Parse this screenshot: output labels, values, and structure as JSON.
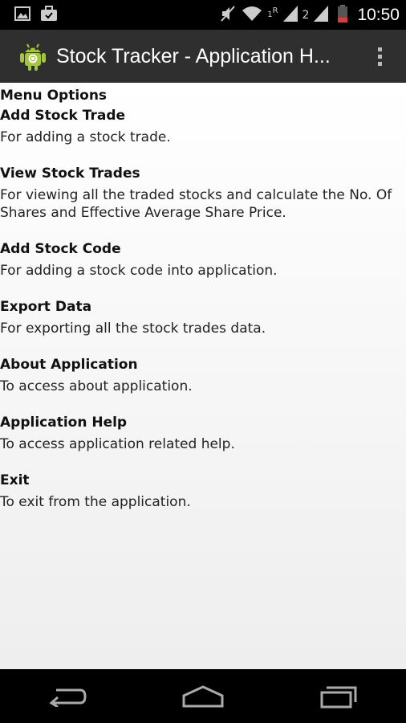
{
  "status_bar": {
    "time": "10:50",
    "signal_1_label": "1",
    "roaming_label": "R",
    "signal_2_label": "2",
    "icons": [
      "image-icon",
      "briefcase-icon",
      "mute-icon",
      "wifi-icon",
      "signal-icon",
      "battery-icon"
    ]
  },
  "action_bar": {
    "title": "Stock Tracker - Application H...",
    "icon": "android-app-icon",
    "overflow_icon": "overflow-menu-icon"
  },
  "content": {
    "header": "Menu Options",
    "items": [
      {
        "title": "Add Stock Trade",
        "desc": "For adding a stock trade."
      },
      {
        "title": "View Stock Trades",
        "desc": "For viewing all the traded stocks and calculate the No. Of Shares and Effective Average Share Price."
      },
      {
        "title": "Add Stock Code",
        "desc": "For adding a stock code into application."
      },
      {
        "title": "Export Data",
        "desc": "For exporting all the stock trades data."
      },
      {
        "title": "About Application",
        "desc": "To access about application."
      },
      {
        "title": "Application Help",
        "desc": "To access application related help."
      },
      {
        "title": "Exit",
        "desc": "To exit from the application."
      }
    ]
  },
  "nav_bar": {
    "buttons": [
      "back-icon",
      "home-icon",
      "recent-apps-icon"
    ]
  },
  "colors": {
    "action_bar": "#2f2f2f",
    "status_bar": "#000000",
    "battery": "#e53935",
    "android_green": "#a4c639"
  }
}
